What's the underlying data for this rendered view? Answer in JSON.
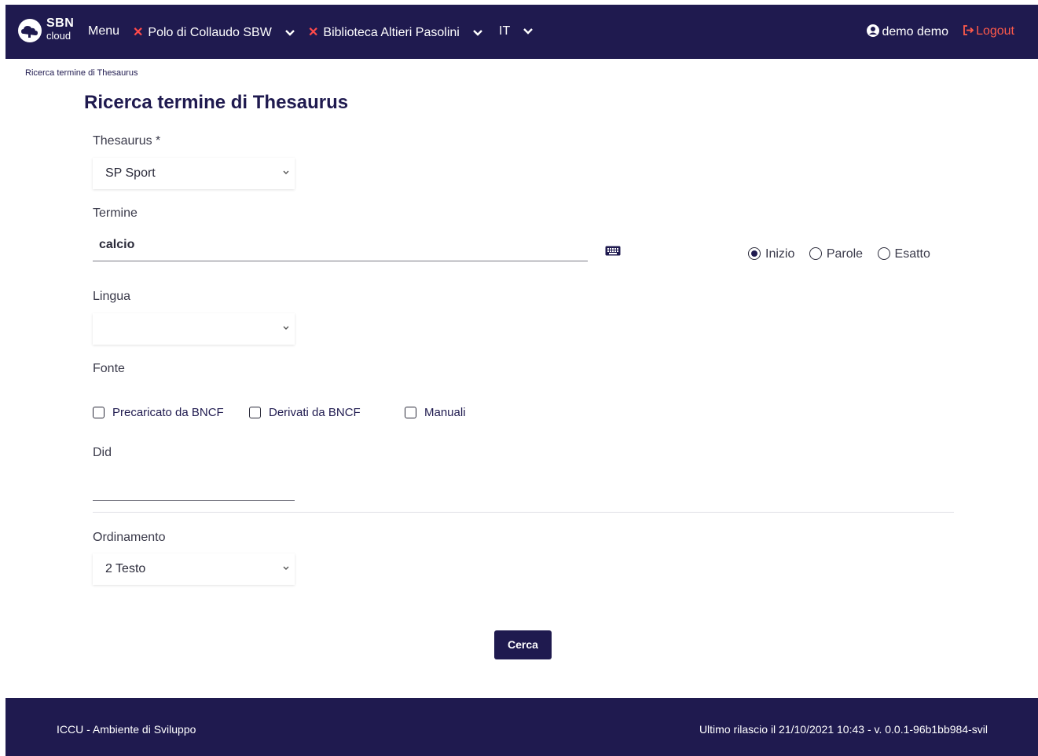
{
  "navbar": {
    "logo_sbn": "SBN",
    "logo_cloud": "cloud",
    "menu_label": "Menu",
    "polo_label": "Polo di Collaudo SBW",
    "biblioteca_label": "Biblioteca Altieri Pasolini",
    "language_label": "IT",
    "user_label": "demo demo",
    "logout_label": "Logout",
    "colors": {
      "background": "#1f1a4f",
      "remove_icon": "#ff4a4a",
      "logout": "#ff5a4a"
    }
  },
  "breadcrumb": "Ricerca termine di Thesaurus",
  "page_title": "Ricerca termine di Thesaurus",
  "form": {
    "thesaurus": {
      "label": "Thesaurus *",
      "value": "SP Sport"
    },
    "termine": {
      "label": "Termine",
      "value": "calcio",
      "keyboard_icon": "keyboard-icon"
    },
    "match_mode": {
      "options": [
        "Inizio",
        "Parole",
        "Esatto"
      ],
      "selected": "Inizio"
    },
    "lingua": {
      "label": "Lingua",
      "value": ""
    },
    "fonte": {
      "label": "Fonte",
      "options": [
        "Precaricato da BNCF",
        "Derivati da BNCF",
        "Manuali"
      ]
    },
    "did": {
      "label": "Did",
      "value": ""
    },
    "ordinamento": {
      "label": "Ordinamento",
      "value": "2 Testo"
    },
    "submit_label": "Cerca"
  },
  "footer": {
    "left": "ICCU - Ambiente di Sviluppo",
    "right": "Ultimo rilascio il 21/10/2021 10:43 - v. 0.0.1-96b1bb984-svil"
  }
}
